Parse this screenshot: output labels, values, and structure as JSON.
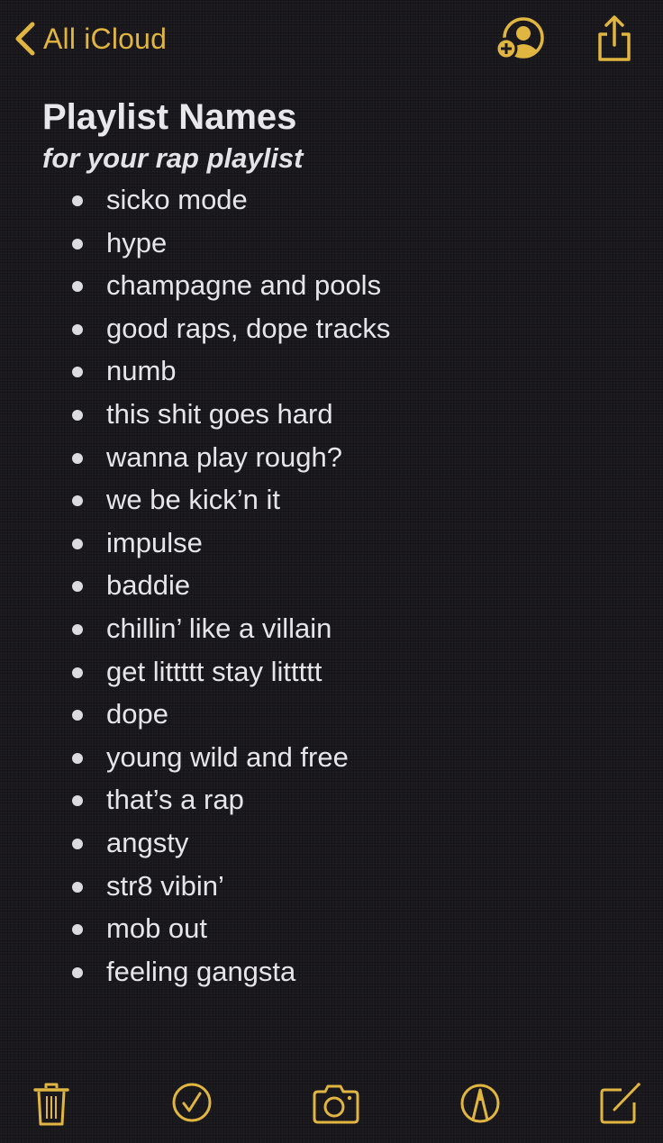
{
  "nav": {
    "back_label": "All iCloud",
    "icons": [
      "chevron-left-icon",
      "add-person-icon",
      "share-icon"
    ]
  },
  "note": {
    "title": "Playlist Names",
    "subtitle": "for your rap playlist",
    "items": [
      "sicko mode",
      "hype",
      "champagne and pools",
      "good raps, dope tracks",
      "numb",
      "this shit goes hard",
      "wanna play rough?",
      "we be kick’n it",
      "impulse",
      "baddie",
      "chillin’ like a villain",
      "get littttt stay littttt",
      "dope",
      "young wild and free",
      "that’s a rap",
      "angsty",
      "str8 vibin’",
      "mob out",
      "feeling gangsta"
    ]
  },
  "toolbar": {
    "icons": [
      "trash-icon",
      "checklist-icon",
      "camera-icon",
      "markup-icon",
      "compose-icon"
    ]
  },
  "colors": {
    "accent": "#e0b540",
    "background": "#1b1a1e",
    "text": "#e6e6e8"
  }
}
